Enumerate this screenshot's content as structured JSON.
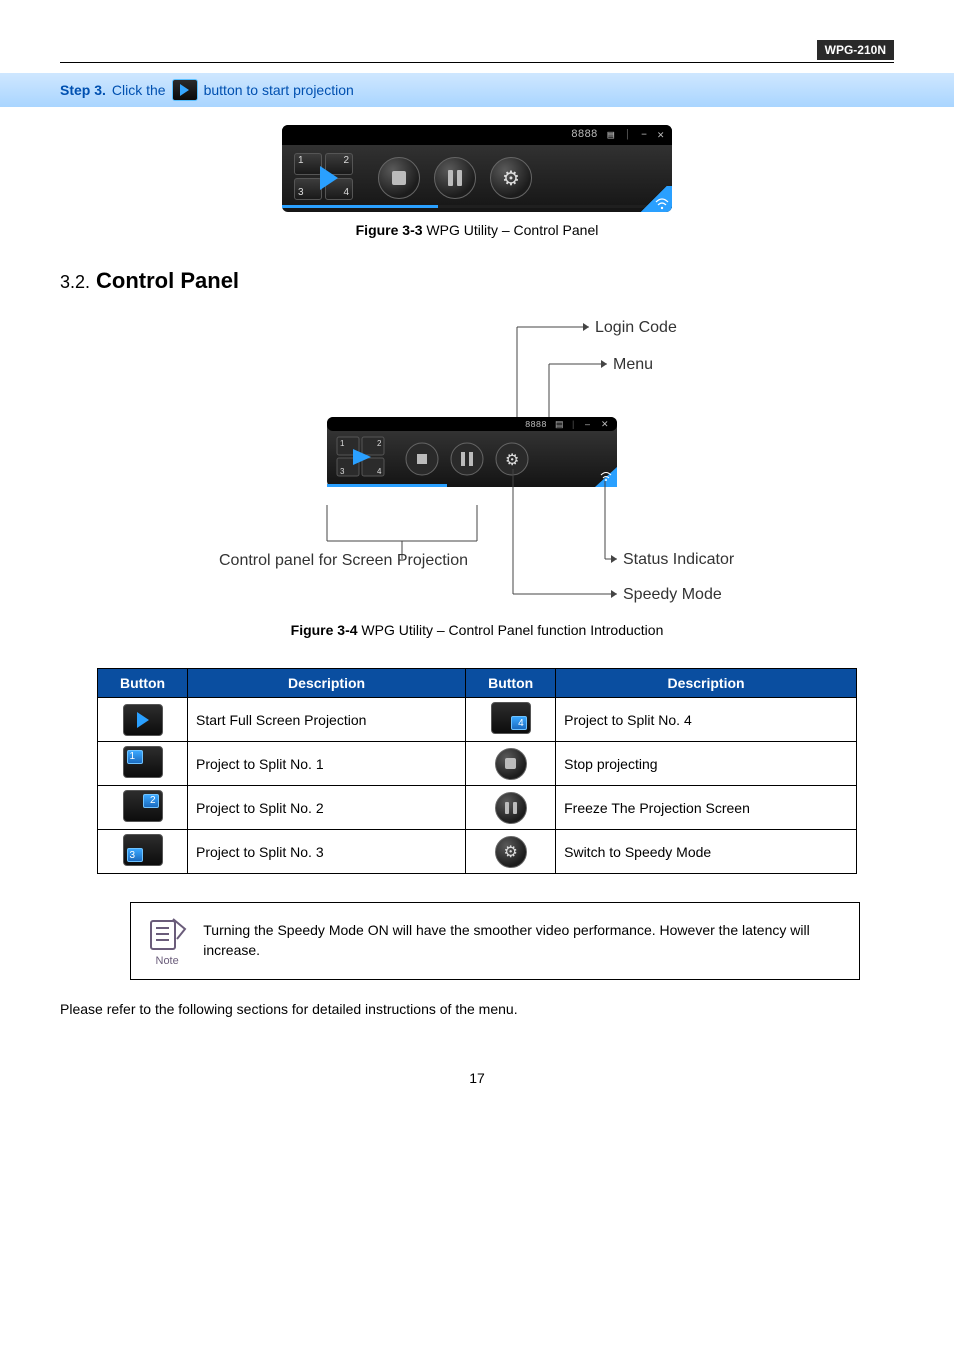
{
  "header": {
    "model": "WPG-210N"
  },
  "step": {
    "label": "Step 3.",
    "text_before": "Click the",
    "text_after": "button to start projection"
  },
  "control_panel": {
    "code": "8888",
    "menu_glyph": "▤",
    "sep": "|",
    "min": "–",
    "close": "✕",
    "grid": {
      "tl": "1",
      "tr": "2",
      "bl": "3",
      "br": "4"
    }
  },
  "figure33": {
    "label": "Figure 3-3",
    "text": " WPG Utility – Control Panel"
  },
  "section": {
    "num": "3.2.",
    "title": "Control Panel"
  },
  "diagram": {
    "login_code": "Login Code",
    "menu": "Menu",
    "control_text": "Control panel for Screen Projection",
    "status": "Status Indicator",
    "speedy": "Speedy Mode",
    "panel_code": "8888"
  },
  "figure34": {
    "label": "Figure 3-4",
    "text": " WPG Utility – Control Panel function Introduction"
  },
  "table": {
    "headers": {
      "button": "Button",
      "description": "Description"
    },
    "rows": [
      {
        "left_desc": "Start Full Screen Projection",
        "right_desc": "Project to Split No. 4"
      },
      {
        "left_desc": "Project to Split No. 1",
        "right_desc": "Stop projecting"
      },
      {
        "left_desc": "Project to Split No. 2",
        "right_desc": "Freeze The Projection Screen"
      },
      {
        "left_desc": "Project to Split No. 3",
        "right_desc": "Switch to Speedy Mode"
      }
    ]
  },
  "note": {
    "caption": "Note",
    "text": "Turning the Speedy Mode ON will have the smoother video performance. However the latency will increase."
  },
  "footer_text": "Please refer to the following sections for detailed instructions of the menu.",
  "page_num": "17"
}
